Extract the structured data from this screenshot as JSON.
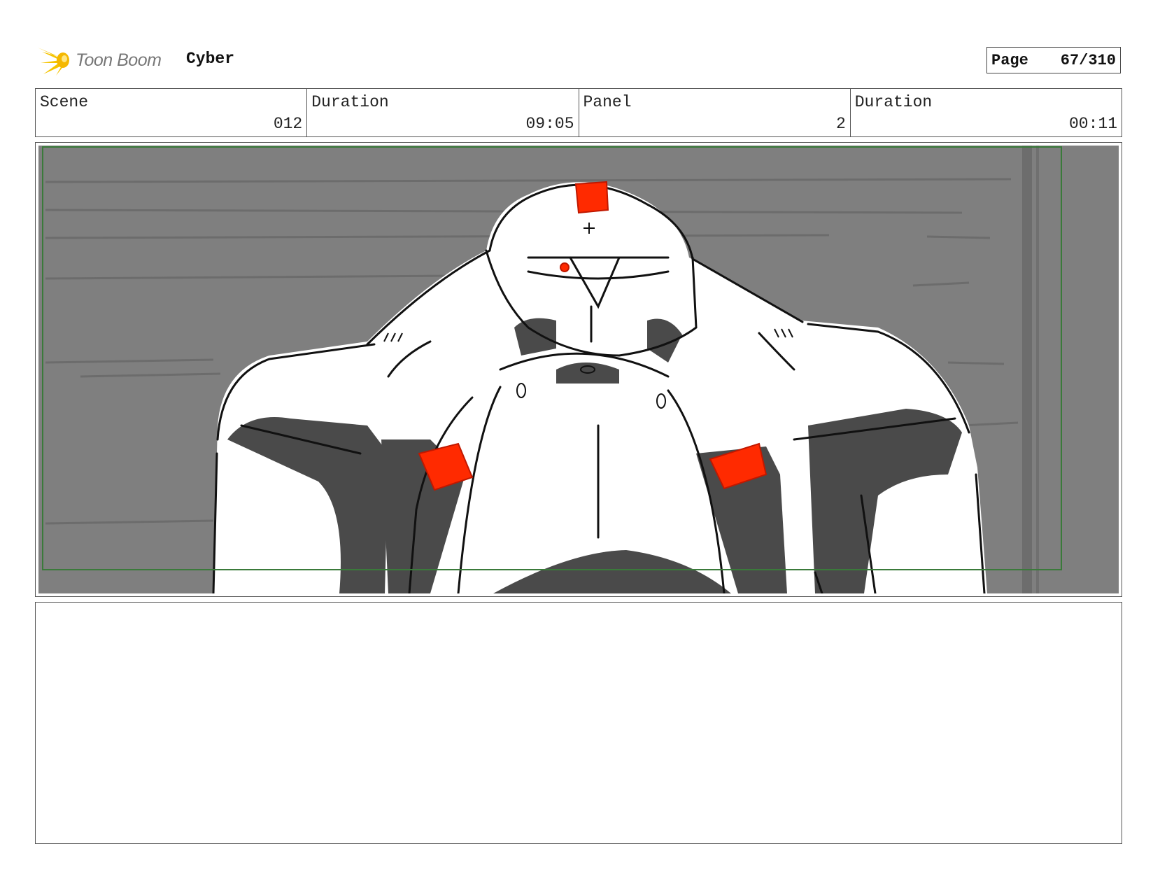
{
  "header": {
    "brand": "Toon Boom",
    "project": "Cyber",
    "page_label": "Page",
    "page_value": "67/310"
  },
  "info": [
    {
      "label": "Scene",
      "value": "012"
    },
    {
      "label": "Duration",
      "value": "09:05"
    },
    {
      "label": "Panel",
      "value": "2"
    },
    {
      "label": "Duration",
      "value": "00:11"
    }
  ],
  "panel": {
    "background_color": "#7f7f7f",
    "accent_color": "#ff2a00",
    "safe_frame_color": "#3a7a3a"
  },
  "notes": {
    "text": ""
  }
}
